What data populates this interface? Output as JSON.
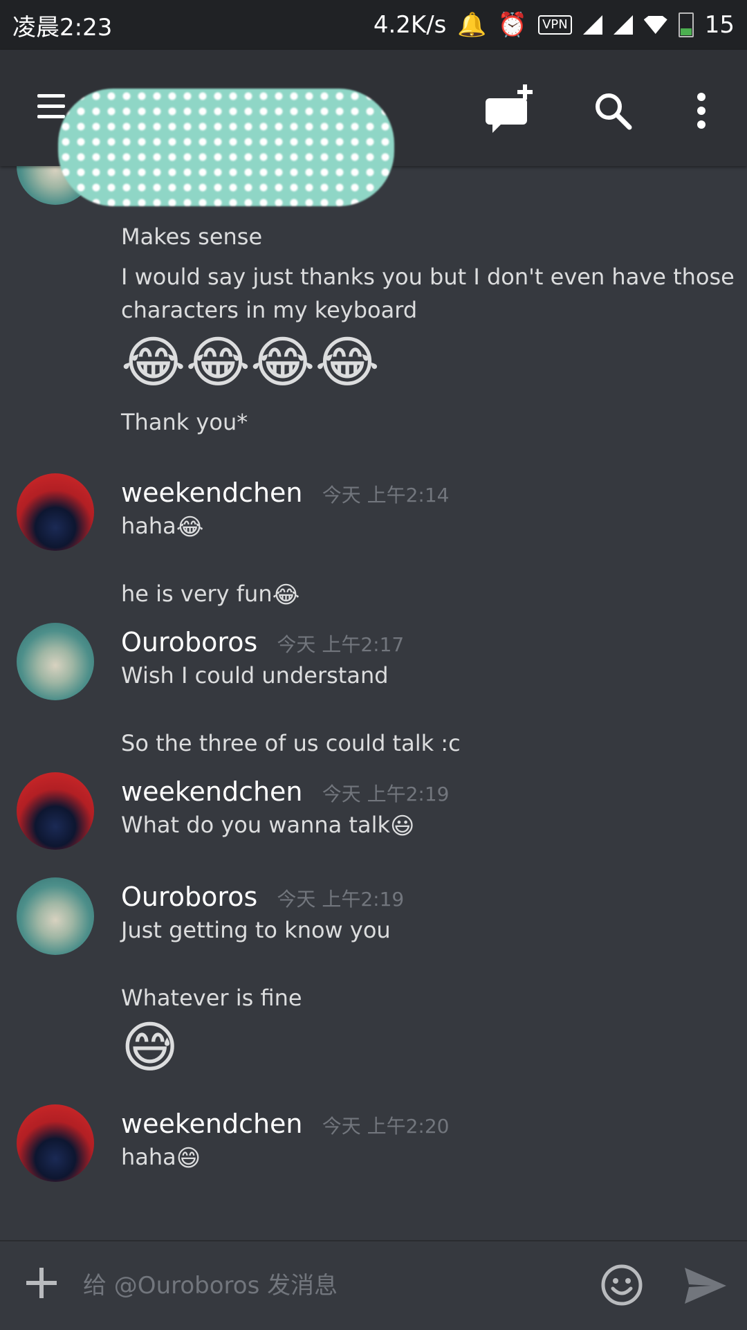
{
  "status_bar": {
    "time": "凌晨2:23",
    "speed": "4.2K/s",
    "vpn": "VPN",
    "battery": "15"
  },
  "header": {
    "new_dm_icon": "chat-plus-icon",
    "search_icon": "search-icon",
    "more_icon": "more-vertical-icon"
  },
  "messages": {
    "m0": {
      "line1": "Makes sense",
      "line2": "I would say just thanks you but I don't even have those",
      "line3": "characters in my keyboard",
      "emojis": "😂😂😂😂",
      "line4": "Thank you*"
    },
    "m1": {
      "author": "weekendchen",
      "ts": "今天 上午2:14",
      "line1": "haha",
      "line2": "he is very fun",
      "emoji": "😂"
    },
    "m2": {
      "author": "Ouroboros",
      "ts": "今天 上午2:17",
      "line1": "Wish I could understand",
      "line2": "So the three of us could talk :c"
    },
    "m3": {
      "author": "weekendchen",
      "ts": "今天 上午2:19",
      "line1": "What do you wanna talk",
      "emoji": "😃"
    },
    "m4": {
      "author": "Ouroboros",
      "ts": "今天 上午2:19",
      "line1": "Just getting to know you",
      "line2": "Whatever is fine",
      "emoji": "😅"
    },
    "m5": {
      "author": "weekendchen",
      "ts": "今天 上午2:20",
      "line1": "haha",
      "emoji": "😄"
    }
  },
  "input": {
    "placeholder": "给 @Ouroboros 发消息",
    "value": ""
  },
  "colors": {
    "background": "#36393f",
    "header": "#2f3136",
    "statusbar": "#202225",
    "timestamp": "#72767d"
  }
}
